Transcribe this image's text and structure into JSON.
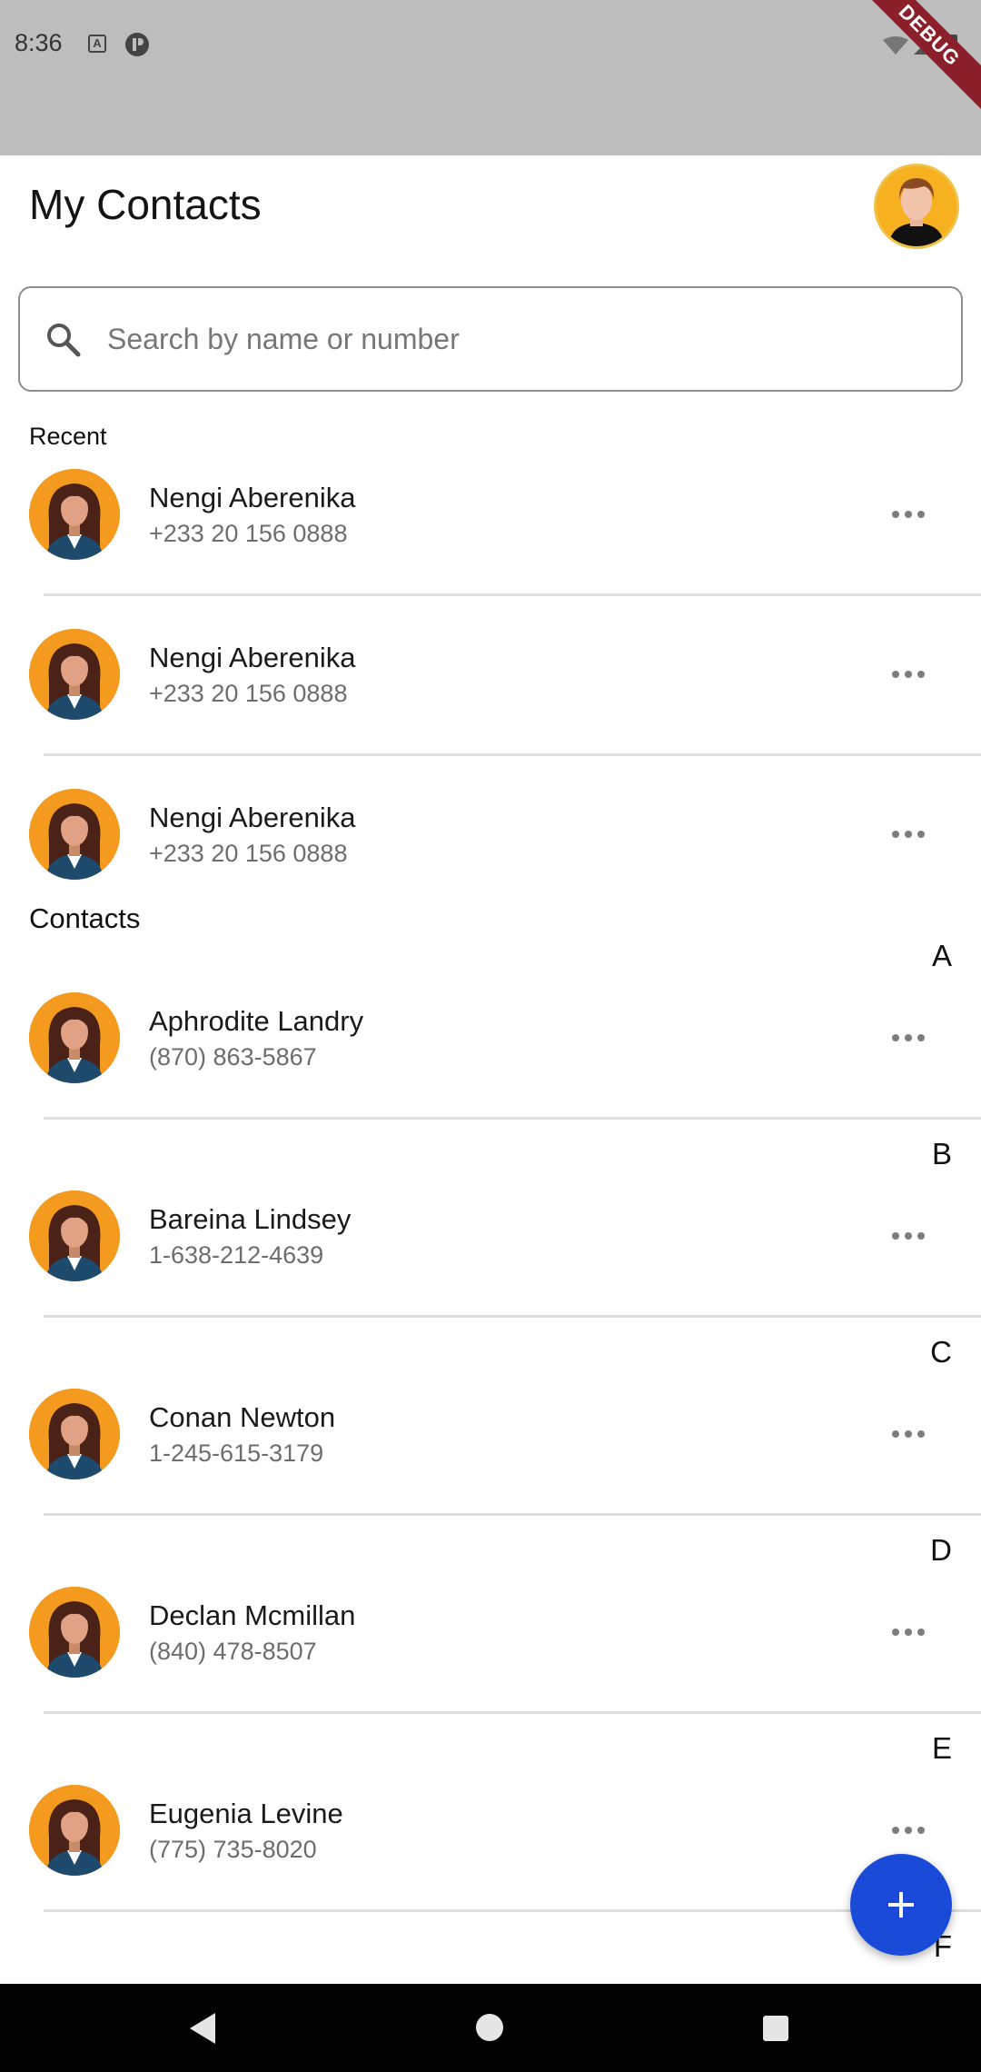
{
  "status_bar": {
    "time": "8:36",
    "debug_label": "DEBUG"
  },
  "header": {
    "title": "My Contacts"
  },
  "search": {
    "placeholder": "Search by name or number",
    "value": ""
  },
  "recent": {
    "label": "Recent",
    "items": [
      {
        "name": "Nengi Aberenika",
        "phone": "+233 20 156 0888"
      },
      {
        "name": "Nengi Aberenika",
        "phone": "+233 20 156 0888"
      },
      {
        "name": "Nengi Aberenika",
        "phone": "+233 20 156 0888"
      }
    ]
  },
  "contacts": {
    "label": "Contacts",
    "groups": [
      {
        "letter": "A",
        "name": "Aphrodite Landry",
        "phone": "(870) 863-5867"
      },
      {
        "letter": "B",
        "name": "Bareina Lindsey",
        "phone": "1-638-212-4639"
      },
      {
        "letter": "C",
        "name": "Conan Newton",
        "phone": "1-245-615-3179"
      },
      {
        "letter": "D",
        "name": "Declan Mcmillan",
        "phone": "(840) 478-8507"
      },
      {
        "letter": "E",
        "name": "Eugenia Levine",
        "phone": "(775) 735-8020"
      },
      {
        "letter": "F"
      }
    ]
  },
  "colors": {
    "accent": "#1a4bd8",
    "avatar_bg": "#f39a1f",
    "status_bar_bg": "#bdbdbd"
  },
  "icons": {
    "search": "search-icon",
    "more": "more-horizontal-icon",
    "add": "plus-icon",
    "nav_back": "back-triangle-icon",
    "nav_home": "home-circle-icon",
    "nav_recents": "recents-square-icon"
  }
}
